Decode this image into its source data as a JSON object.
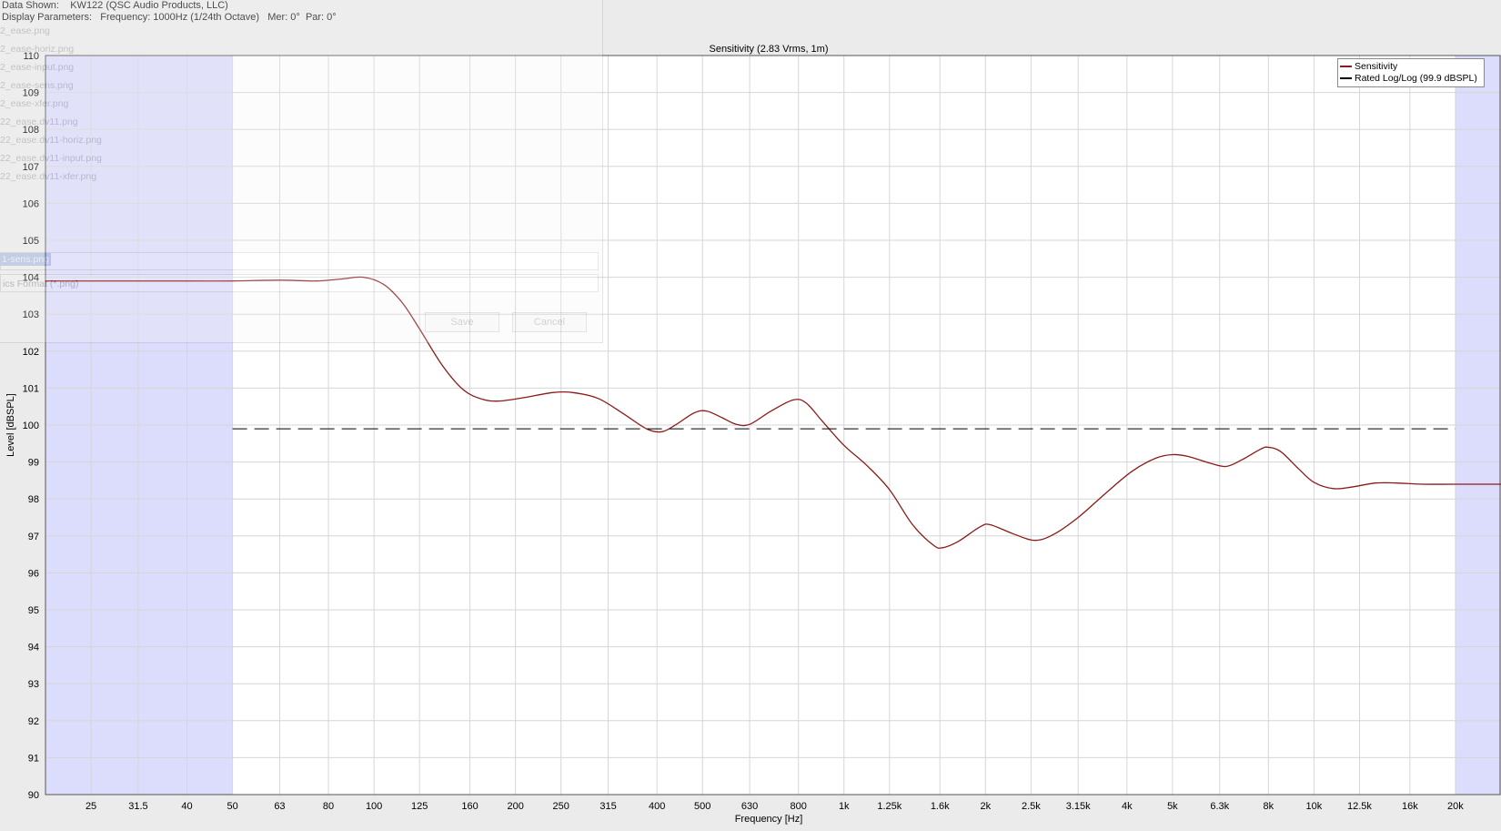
{
  "header": {
    "data_shown_label": "Data Shown:",
    "data_shown_value": "KW122 (QSC Audio Products, LLC)",
    "params_label": "Display Parameters:",
    "params_value": "Frequency: 1000Hz (1/24th Octave)   Mer: 0°  Par: 0°"
  },
  "save_dialog": {
    "files": [
      "2_ease.png",
      "2_ease-horiz.png",
      "2_ease-input.png",
      "2_ease-sens.png",
      "2_ease-xfer.png",
      "22_ease.dv11.png",
      "22_ease.dv11-horiz.png",
      "22_ease.dv11-input.png",
      "22_ease.dv11-xfer.png"
    ],
    "filename": "1-sens.png",
    "filetype": "ics Format (*.png)",
    "save_label": "Save",
    "cancel_label": "Cancel"
  },
  "chart_data": {
    "type": "line",
    "title": "Sensitivity (2.83 Vrms, 1m)",
    "xlabel": "Frequency [Hz]",
    "ylabel": "Level [dBSPL]",
    "x_scale": "log",
    "xlim": [
      20,
      25000
    ],
    "ylim": [
      90,
      110
    ],
    "grid": true,
    "legend_position": "top-right",
    "x_ticks": [
      {
        "value": 25,
        "label": "25"
      },
      {
        "value": 31.5,
        "label": "31.5"
      },
      {
        "value": 40,
        "label": "40"
      },
      {
        "value": 50,
        "label": "50"
      },
      {
        "value": 63,
        "label": "63"
      },
      {
        "value": 80,
        "label": "80"
      },
      {
        "value": 100,
        "label": "100"
      },
      {
        "value": 125,
        "label": "125"
      },
      {
        "value": 160,
        "label": "160"
      },
      {
        "value": 200,
        "label": "200"
      },
      {
        "value": 250,
        "label": "250"
      },
      {
        "value": 315,
        "label": "315"
      },
      {
        "value": 400,
        "label": "400"
      },
      {
        "value": 500,
        "label": "500"
      },
      {
        "value": 630,
        "label": "630"
      },
      {
        "value": 800,
        "label": "800"
      },
      {
        "value": 1000,
        "label": "1k"
      },
      {
        "value": 1250,
        "label": "1.25k"
      },
      {
        "value": 1600,
        "label": "1.6k"
      },
      {
        "value": 2000,
        "label": "2k"
      },
      {
        "value": 2500,
        "label": "2.5k"
      },
      {
        "value": 3150,
        "label": "3.15k"
      },
      {
        "value": 4000,
        "label": "4k"
      },
      {
        "value": 5000,
        "label": "5k"
      },
      {
        "value": 6300,
        "label": "6.3k"
      },
      {
        "value": 8000,
        "label": "8k"
      },
      {
        "value": 10000,
        "label": "10k"
      },
      {
        "value": 12500,
        "label": "12.5k"
      },
      {
        "value": 16000,
        "label": "16k"
      },
      {
        "value": 20000,
        "label": "20k"
      }
    ],
    "y_ticks": [
      90,
      91,
      92,
      93,
      94,
      95,
      96,
      97,
      98,
      99,
      100,
      101,
      102,
      103,
      104,
      105,
      106,
      107,
      108,
      109,
      110
    ],
    "shaded_regions": [
      {
        "from": 20,
        "to": 50,
        "color": "#dcdcfc"
      },
      {
        "from": 20000,
        "to": 25000,
        "color": "#dcdcfc"
      }
    ],
    "series": [
      {
        "name": "Sensitivity",
        "color": "#8b1a1a",
        "style": "solid",
        "points": [
          [
            20,
            103.9
          ],
          [
            30,
            103.9
          ],
          [
            40,
            103.9
          ],
          [
            50,
            103.9
          ],
          [
            63,
            103.92
          ],
          [
            75,
            103.9
          ],
          [
            85,
            103.95
          ],
          [
            95,
            104.0
          ],
          [
            105,
            103.8
          ],
          [
            115,
            103.3
          ],
          [
            125,
            102.6
          ],
          [
            140,
            101.6
          ],
          [
            155,
            100.95
          ],
          [
            170,
            100.7
          ],
          [
            185,
            100.65
          ],
          [
            210,
            100.75
          ],
          [
            240,
            100.88
          ],
          [
            265,
            100.88
          ],
          [
            300,
            100.72
          ],
          [
            340,
            100.3
          ],
          [
            380,
            99.9
          ],
          [
            410,
            99.82
          ],
          [
            440,
            100.02
          ],
          [
            480,
            100.33
          ],
          [
            510,
            100.38
          ],
          [
            550,
            100.2
          ],
          [
            590,
            100.02
          ],
          [
            630,
            100.02
          ],
          [
            700,
            100.38
          ],
          [
            780,
            100.68
          ],
          [
            830,
            100.6
          ],
          [
            900,
            100.1
          ],
          [
            1000,
            99.45
          ],
          [
            1120,
            98.9
          ],
          [
            1250,
            98.25
          ],
          [
            1400,
            97.3
          ],
          [
            1550,
            96.75
          ],
          [
            1620,
            96.68
          ],
          [
            1750,
            96.85
          ],
          [
            1950,
            97.25
          ],
          [
            2050,
            97.3
          ],
          [
            2300,
            97.05
          ],
          [
            2550,
            96.88
          ],
          [
            2800,
            97.05
          ],
          [
            3150,
            97.5
          ],
          [
            3600,
            98.15
          ],
          [
            4100,
            98.75
          ],
          [
            4600,
            99.1
          ],
          [
            5000,
            99.2
          ],
          [
            5400,
            99.15
          ],
          [
            6000,
            98.97
          ],
          [
            6500,
            98.88
          ],
          [
            7000,
            99.05
          ],
          [
            7700,
            99.35
          ],
          [
            8000,
            99.4
          ],
          [
            8500,
            99.28
          ],
          [
            9300,
            98.8
          ],
          [
            10000,
            98.45
          ],
          [
            11000,
            98.28
          ],
          [
            12000,
            98.32
          ],
          [
            13500,
            98.43
          ],
          [
            15000,
            98.43
          ],
          [
            17000,
            98.4
          ],
          [
            20000,
            98.4
          ],
          [
            25000,
            98.4
          ]
        ]
      },
      {
        "name": "Rated Log/Log (99.9 dBSPL)",
        "color": "#000000",
        "style": "dashed",
        "points": [
          [
            50,
            99.9
          ],
          [
            20000,
            99.9
          ]
        ]
      }
    ]
  }
}
